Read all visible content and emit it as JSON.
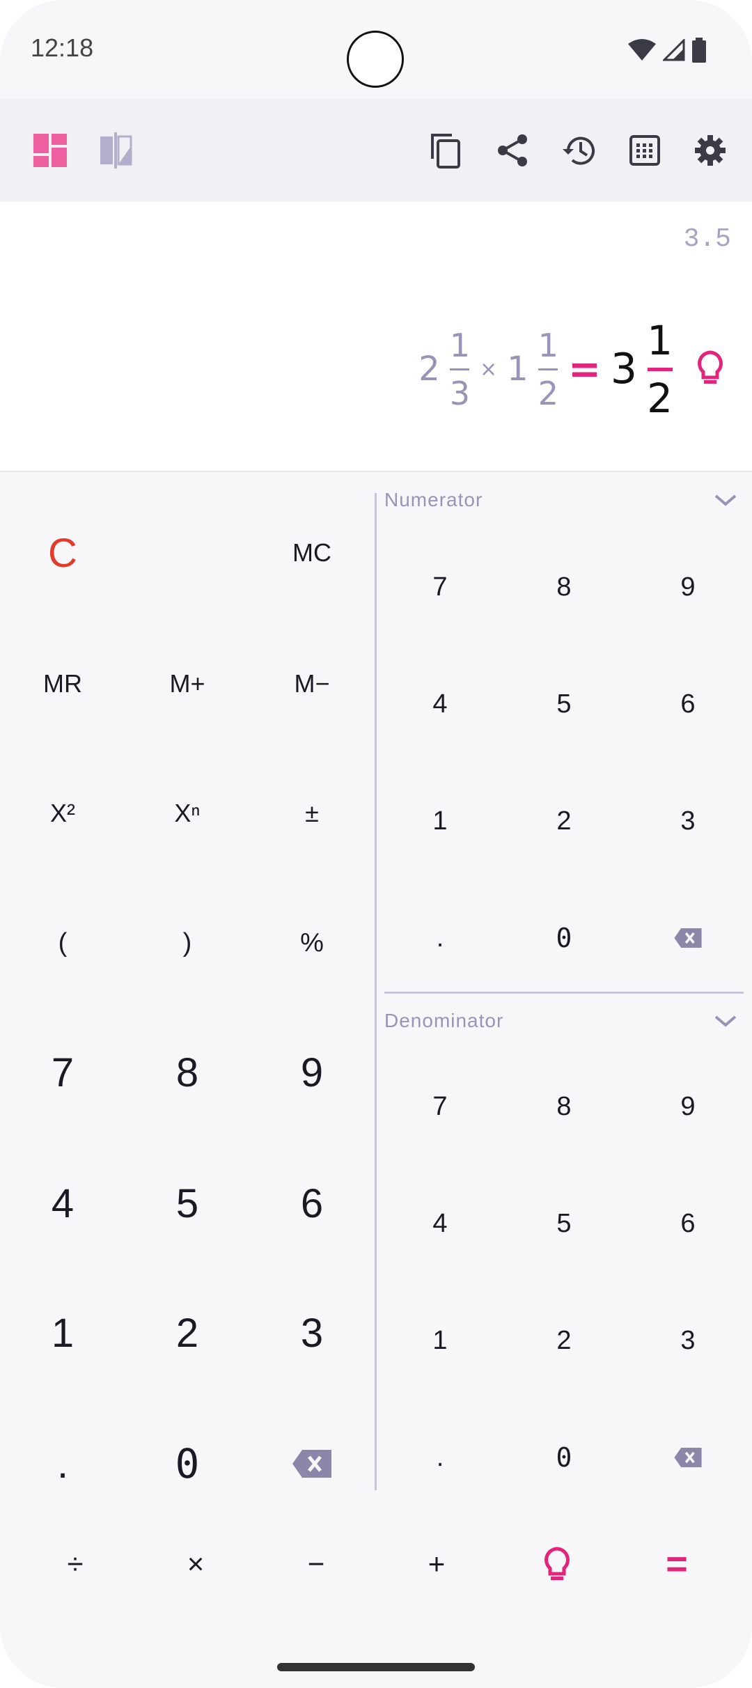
{
  "status_bar": {
    "time": "12:18"
  },
  "display": {
    "preview": "3.5",
    "expression": {
      "a_whole": "2",
      "a_num": "1",
      "a_den": "3",
      "operator": "×",
      "b_whole": "1",
      "b_num": "1",
      "b_den": "2",
      "equals": "=",
      "result_whole": "3",
      "result_num": "1",
      "result_den": "2"
    }
  },
  "left_keypad": {
    "row1": [
      "C",
      "MC"
    ],
    "row2": [
      "MR",
      "M+",
      "M−"
    ],
    "row3": [
      "X²",
      "Xⁿ",
      "±"
    ],
    "row4": [
      "(",
      ")",
      "%"
    ],
    "row5": [
      "7",
      "8",
      "9"
    ],
    "row6": [
      "4",
      "5",
      "6"
    ],
    "row7": [
      "1",
      "2",
      "3"
    ],
    "row8": [
      ".",
      "0"
    ]
  },
  "numerator": {
    "label": "Numerator",
    "rows": [
      [
        "7",
        "8",
        "9"
      ],
      [
        "4",
        "5",
        "6"
      ],
      [
        "1",
        "2",
        "3"
      ],
      [
        ".",
        "0"
      ]
    ]
  },
  "denominator": {
    "label": "Denominator",
    "rows": [
      [
        "7",
        "8",
        "9"
      ],
      [
        "4",
        "5",
        "6"
      ],
      [
        "1",
        "2",
        "3"
      ],
      [
        ".",
        "0"
      ]
    ]
  },
  "operators": [
    "÷",
    "×",
    "−",
    "+",
    "="
  ],
  "colors": {
    "accent": "#e2247b",
    "clear": "#e23a2b",
    "muted": "#9a93b8",
    "icon": "#3b3b45"
  }
}
